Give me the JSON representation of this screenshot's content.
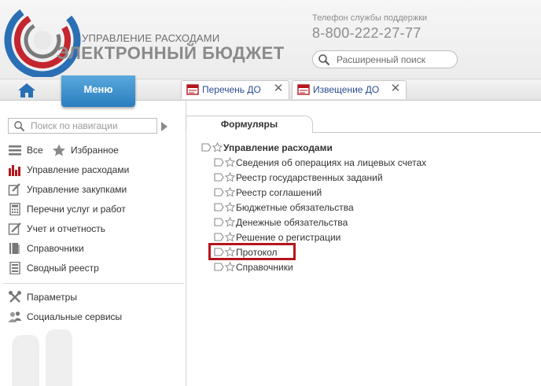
{
  "header": {
    "brand_subtitle": "УПРАВЛЕНИЕ РАСХОДАМИ",
    "brand_title": "ЭЛЕКТРОННЫЙ БЮДЖЕТ",
    "support_label": "Телефон службы поддержки",
    "support_phone": "8-800-222-27-77",
    "search_placeholder": "Расширенный поиск"
  },
  "tabbar": {
    "menu_label": "Меню",
    "tabs": [
      {
        "label": "Перечень ДО"
      },
      {
        "label": "Извещение ДО"
      }
    ]
  },
  "sidebar": {
    "search_placeholder": "Поиск по навигации",
    "all_label": "Все",
    "favorites_label": "Избранное",
    "items": [
      {
        "label": "Управление расходами",
        "icon": "chart-icon"
      },
      {
        "label": "Управление закупками",
        "icon": "edit-icon"
      },
      {
        "label": "Перечни услуг и работ",
        "icon": "calculator-icon"
      },
      {
        "label": "Учет и отчетность",
        "icon": "pencil-icon"
      },
      {
        "label": "Справочники",
        "icon": "book-icon"
      },
      {
        "label": "Сводный реестр",
        "icon": "register-icon"
      }
    ],
    "bottom_items": [
      {
        "label": "Параметры",
        "icon": "wrench-icon"
      },
      {
        "label": "Социальные сервисы",
        "icon": "users-icon"
      }
    ]
  },
  "main": {
    "panel_tab": "Формуляры",
    "tree_root": "Управление расходами",
    "tree_items": [
      "Сведения об операциях на лицевых счетах",
      "Реестр государственных заданий",
      "Реестр соглашений",
      "Бюджетные обязательства",
      "Денежные обязательства",
      "Решение о регистрации",
      "Протокол",
      "Справочники"
    ],
    "highlighted_item": "Протокол",
    "highlight_color": "#b3161c"
  },
  "colors": {
    "menu_button": "#2a7ec0",
    "tab_text": "#2a4d8f",
    "logo_red": "#c4262e",
    "logo_blue": "#1f5fa8"
  }
}
